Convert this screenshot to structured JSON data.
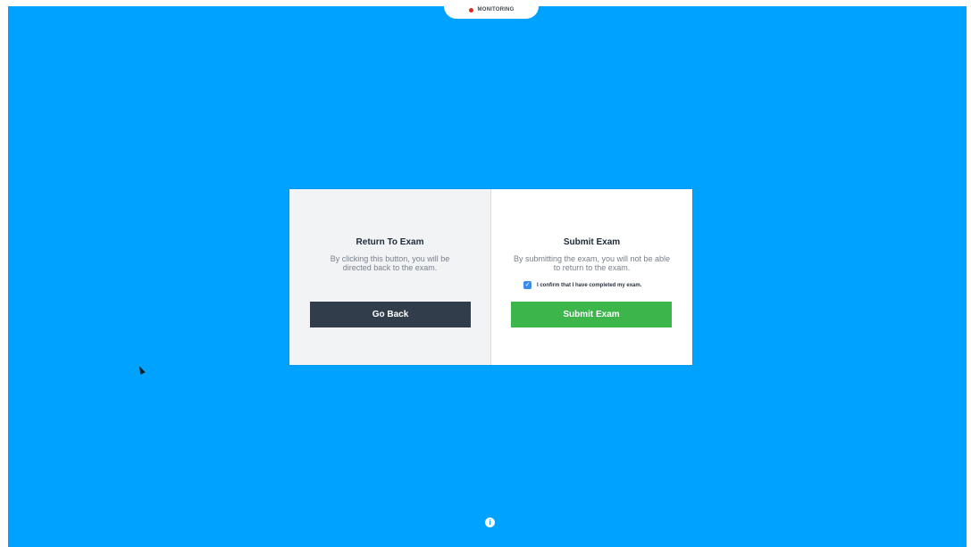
{
  "monitoring": {
    "label": "MONITORING",
    "dot_color": "#e0281e"
  },
  "return_panel": {
    "title": "Return To Exam",
    "description": "By clicking this button, you will be directed back to the exam.",
    "button_label": "Go Back"
  },
  "submit_panel": {
    "title": "Submit Exam",
    "description": "By submitting the exam, you will not be able to return to the exam.",
    "confirm_label": "I confirm that I have completed my exam.",
    "confirm_checked": true,
    "button_label": "Submit Exam"
  },
  "info": {
    "icon": "info-icon",
    "glyph": "i"
  },
  "colors": {
    "background": "#00a2ff",
    "go_back_button": "#323d4c",
    "submit_button": "#3cb64b",
    "checkbox": "#3d8ce8"
  }
}
